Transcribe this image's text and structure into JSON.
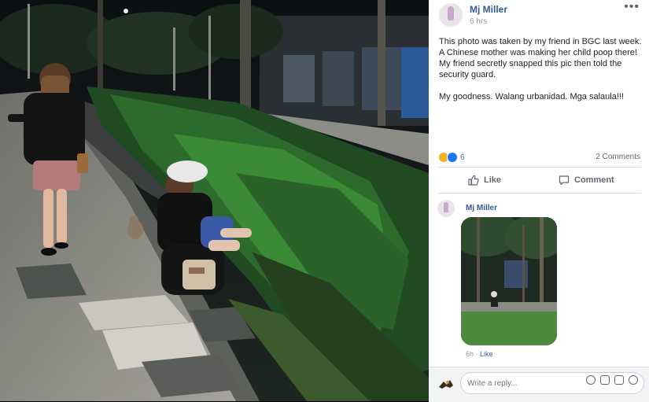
{
  "post": {
    "author": "Mj Miller",
    "time": "6 hrs",
    "more_label": "•••",
    "text": "This photo was taken by my friend in BGC last week. A Chinese mother was making her child poop there! My friend secretly snapped this pic then told the security guard.\n\nMy goodness. Walang urbanidad. Mga salaula!!!",
    "reaction_count": "6",
    "comments_count": "2 Comments",
    "like_label": "Like",
    "comment_label": "Comment"
  },
  "comment": {
    "author": "Mj Miller",
    "time": "6h",
    "separator": " · ",
    "like_label": "Like"
  },
  "reply": {
    "placeholder": "Write a reply..."
  },
  "icons": [
    "more-options-icon",
    "haha-reaction-icon",
    "like-reaction-icon",
    "thumbs-up-icon",
    "comment-bubble-icon",
    "emoji-icon",
    "camera-icon",
    "gif-icon",
    "sticker-icon"
  ]
}
